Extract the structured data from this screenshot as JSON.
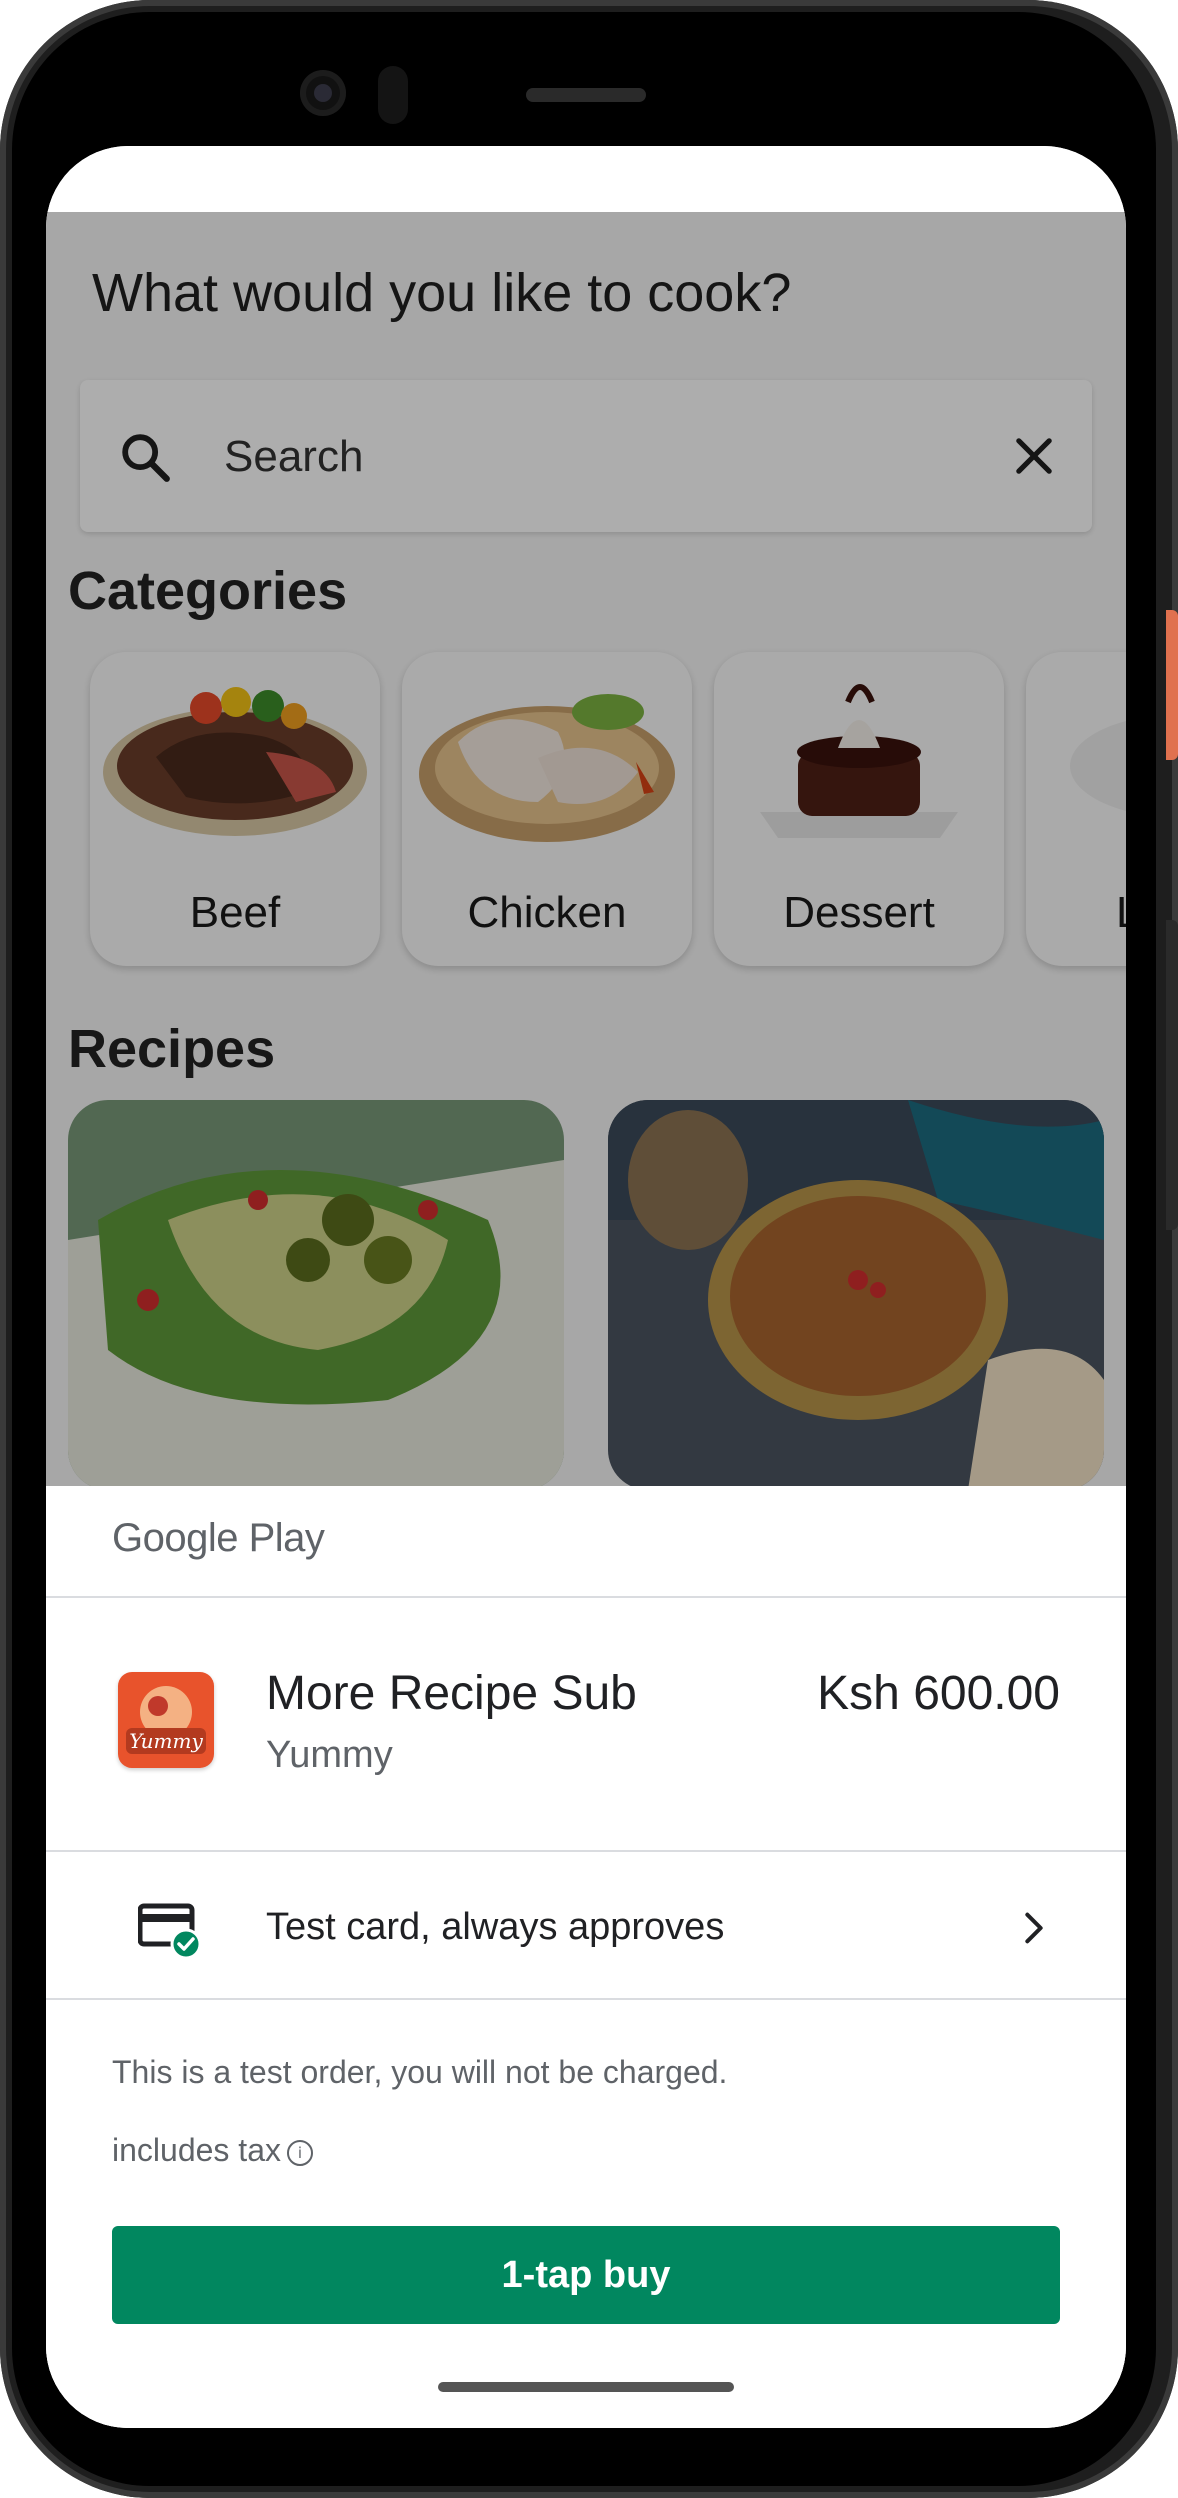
{
  "app": {
    "title": "What would you like to cook?",
    "search": {
      "placeholder": "Search"
    },
    "categories_heading": "Categories",
    "categories": [
      {
        "label": "Beef"
      },
      {
        "label": "Chicken"
      },
      {
        "label": "Dessert"
      },
      {
        "label": "L"
      }
    ],
    "recipes_heading": "Recipes"
  },
  "purchase_sheet": {
    "store_logo": "Google Play",
    "product_title": "More Recipe Sub",
    "product_subtitle": "Yummy",
    "product_icon_text": "Yummy",
    "price": "Ksh 600.00",
    "payment_method": "Test card, always approves",
    "test_note": "This is a test order, you will not be charged.",
    "tax_note": "includes tax",
    "info_glyph": "i",
    "buy_label": "1-tap buy"
  },
  "colors": {
    "buy_button": "#01875f",
    "scrim": "rgba(0,0,0,0.32)",
    "approved_badge": "#01875f"
  }
}
